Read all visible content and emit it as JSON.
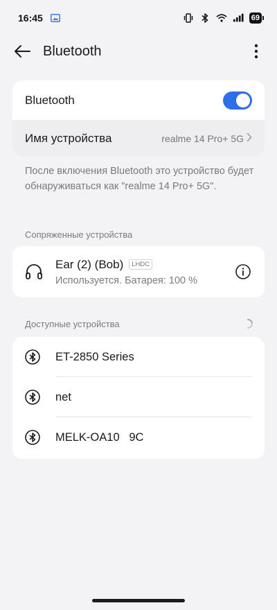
{
  "status_bar": {
    "time": "16:45",
    "battery_level": "69"
  },
  "app_bar": {
    "title": "Bluetooth"
  },
  "bluetooth_card": {
    "toggle_label": "Bluetooth",
    "toggle_on": true,
    "device_name_label": "Имя устройства",
    "device_name_value": "realme 14 Pro+ 5G"
  },
  "hint": "После включения Bluetooth это устройство будет обнаруживаться как \"realme 14 Pro+ 5G\".",
  "paired": {
    "section_title": "Сопряженные устройства",
    "devices": [
      {
        "name": "Ear (2) (Bob)",
        "codec": "LHDC",
        "status": "Используется. Батарея: 100 %"
      }
    ]
  },
  "available": {
    "section_title": "Доступные устройства",
    "devices": [
      {
        "name": "ET-2850 Series"
      },
      {
        "name": "net"
      },
      {
        "name": "MELK-OA10   9C"
      }
    ]
  },
  "colors": {
    "accent": "#2d6ee9",
    "background": "#f3f3f5",
    "card": "#ffffff",
    "secondary_text": "#7a7a7a"
  }
}
